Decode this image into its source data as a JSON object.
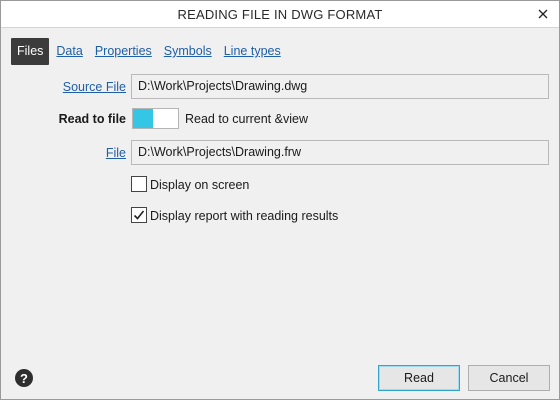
{
  "window": {
    "title": "READING FILE IN DWG FORMAT",
    "close_icon": "close-icon"
  },
  "tabs": [
    {
      "label": "Files",
      "active": true
    },
    {
      "label": "Data",
      "active": false
    },
    {
      "label": "Properties",
      "active": false
    },
    {
      "label": "Symbols",
      "active": false
    },
    {
      "label": "Line types",
      "active": false
    }
  ],
  "source_file": {
    "label": "Source File",
    "value": "D:\\Work\\Projects\\Drawing.dwg"
  },
  "read_to_file": {
    "label": "Read to file",
    "toggle_on": true,
    "option_text": "Read to current &view"
  },
  "file": {
    "label": "File",
    "value": "D:\\Work\\Projects\\Drawing.frw"
  },
  "options": {
    "display_on_screen": {
      "label": "Display on screen",
      "checked": false
    },
    "display_report": {
      "label": "Display report with reading results",
      "checked": true
    }
  },
  "footer": {
    "help_icon": "help-icon",
    "help_text": "?",
    "read_label": "Read",
    "cancel_label": "Cancel"
  },
  "colors": {
    "accent": "#35c6e6",
    "link": "#1f5fa8",
    "active_tab": "#3b3b3b"
  }
}
